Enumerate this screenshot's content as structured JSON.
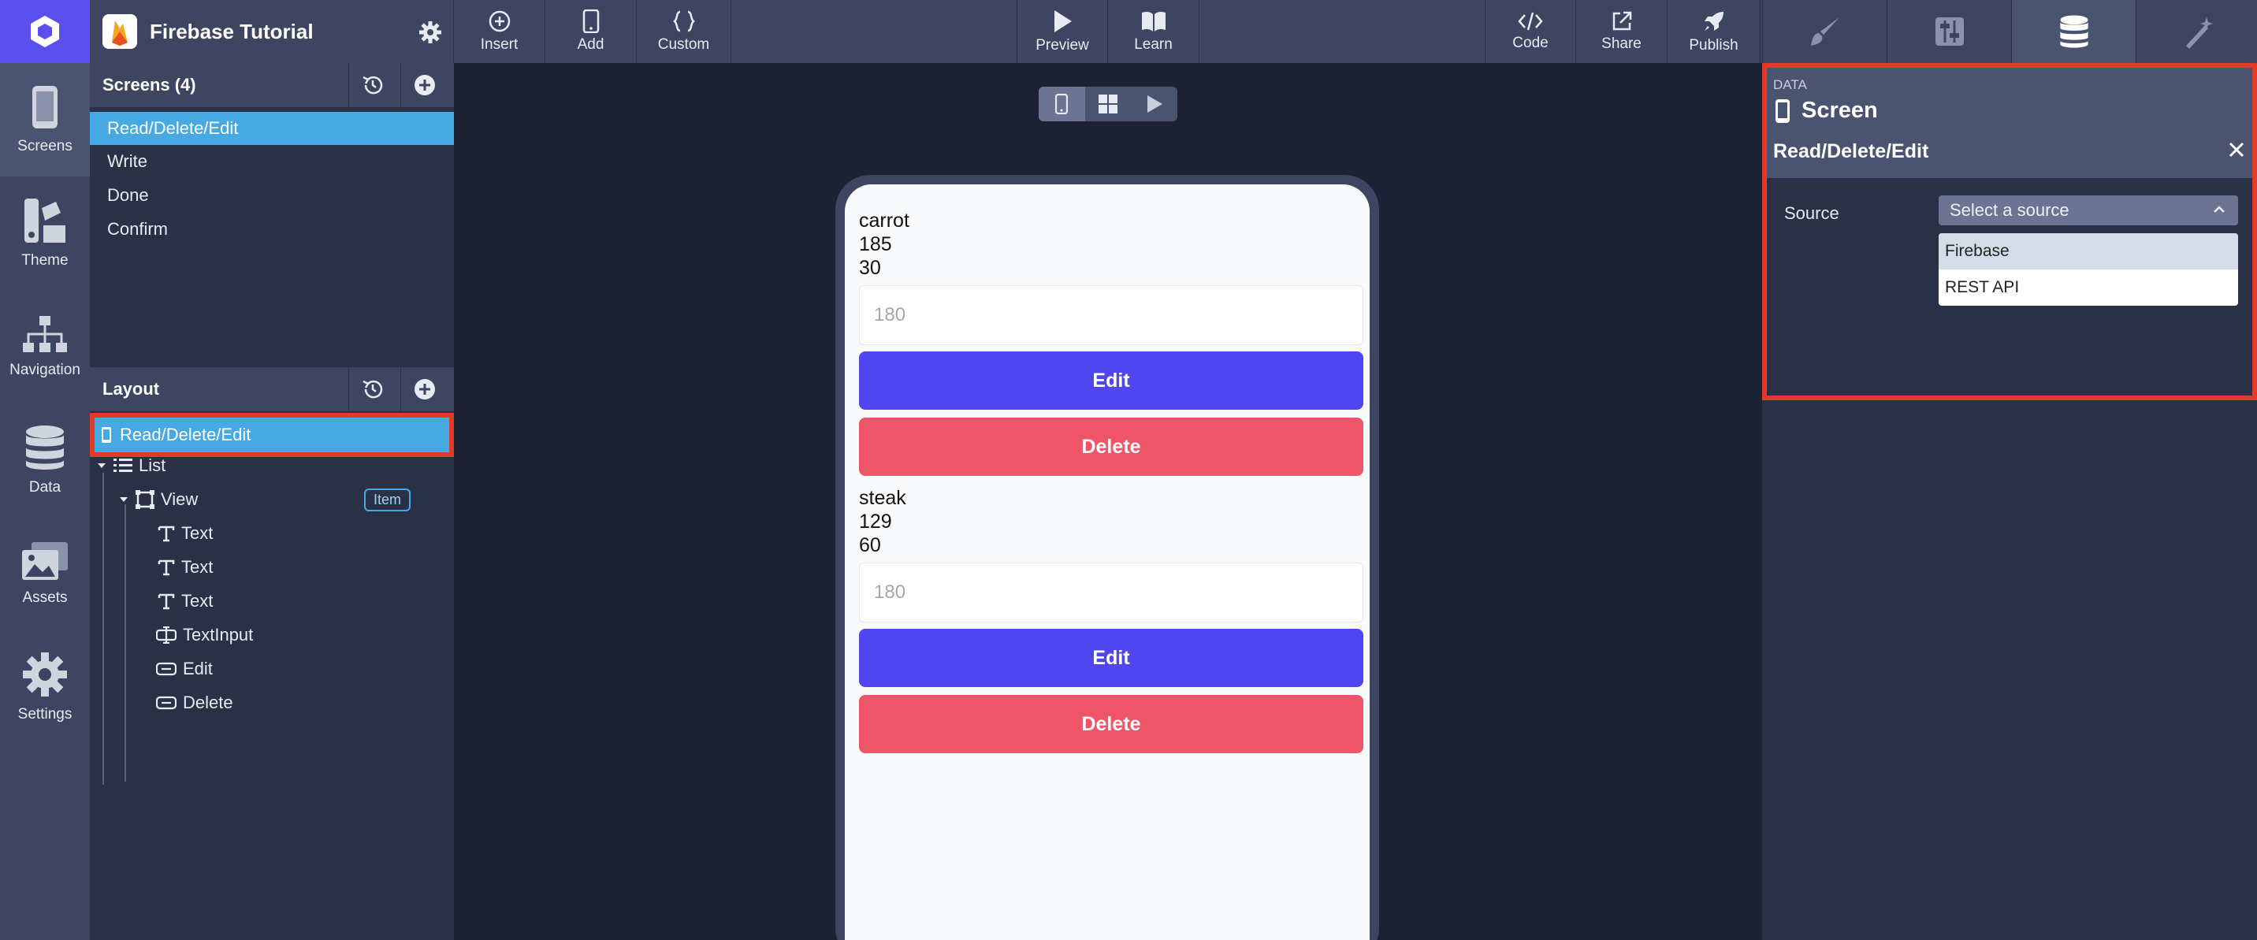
{
  "rail": {
    "items": [
      {
        "label": "Screens",
        "icon": "phone-icon"
      },
      {
        "label": "Theme",
        "icon": "palette-icon"
      },
      {
        "label": "Navigation",
        "icon": "sitemap-icon"
      },
      {
        "label": "Data",
        "icon": "database-icon"
      },
      {
        "label": "Assets",
        "icon": "images-icon"
      },
      {
        "label": "Settings",
        "icon": "gear-icon"
      }
    ]
  },
  "topbar": {
    "project_title": "Firebase Tutorial",
    "buttons": {
      "insert": "Insert",
      "add": "Add",
      "custom": "Custom",
      "preview": "Preview",
      "learn": "Learn",
      "code": "Code",
      "share": "Share",
      "publish": "Publish"
    }
  },
  "screens_panel": {
    "title": "Screens (4)",
    "items": [
      "Read/Delete/Edit",
      "Write",
      "Done",
      "Confirm"
    ]
  },
  "layout_panel": {
    "title": "Layout",
    "root": "Read/Delete/Edit",
    "list": "List",
    "view": "View",
    "item_badge": "Item",
    "children": [
      "Text",
      "Text",
      "Text",
      "TextInput",
      "Edit",
      "Delete"
    ]
  },
  "phone": {
    "items": [
      {
        "name": "carrot",
        "v1": "185",
        "v2": "30",
        "placeholder": "180",
        "edit": "Edit",
        "delete": "Delete"
      },
      {
        "name": "steak",
        "v1": "129",
        "v2": "60",
        "placeholder": "180",
        "edit": "Edit",
        "delete": "Delete"
      }
    ]
  },
  "data_panel": {
    "tag": "DATA",
    "title": "Screen",
    "screen_name": "Read/Delete/Edit",
    "source_label": "Source",
    "source_placeholder": "Select a source",
    "options": [
      "Firebase",
      "REST API"
    ]
  },
  "colors": {
    "accent": "#5b50ee",
    "selected": "#47a9e1",
    "edit_button": "#4f46f0",
    "delete_button": "#ee5568",
    "highlight": "#e33a2c"
  }
}
